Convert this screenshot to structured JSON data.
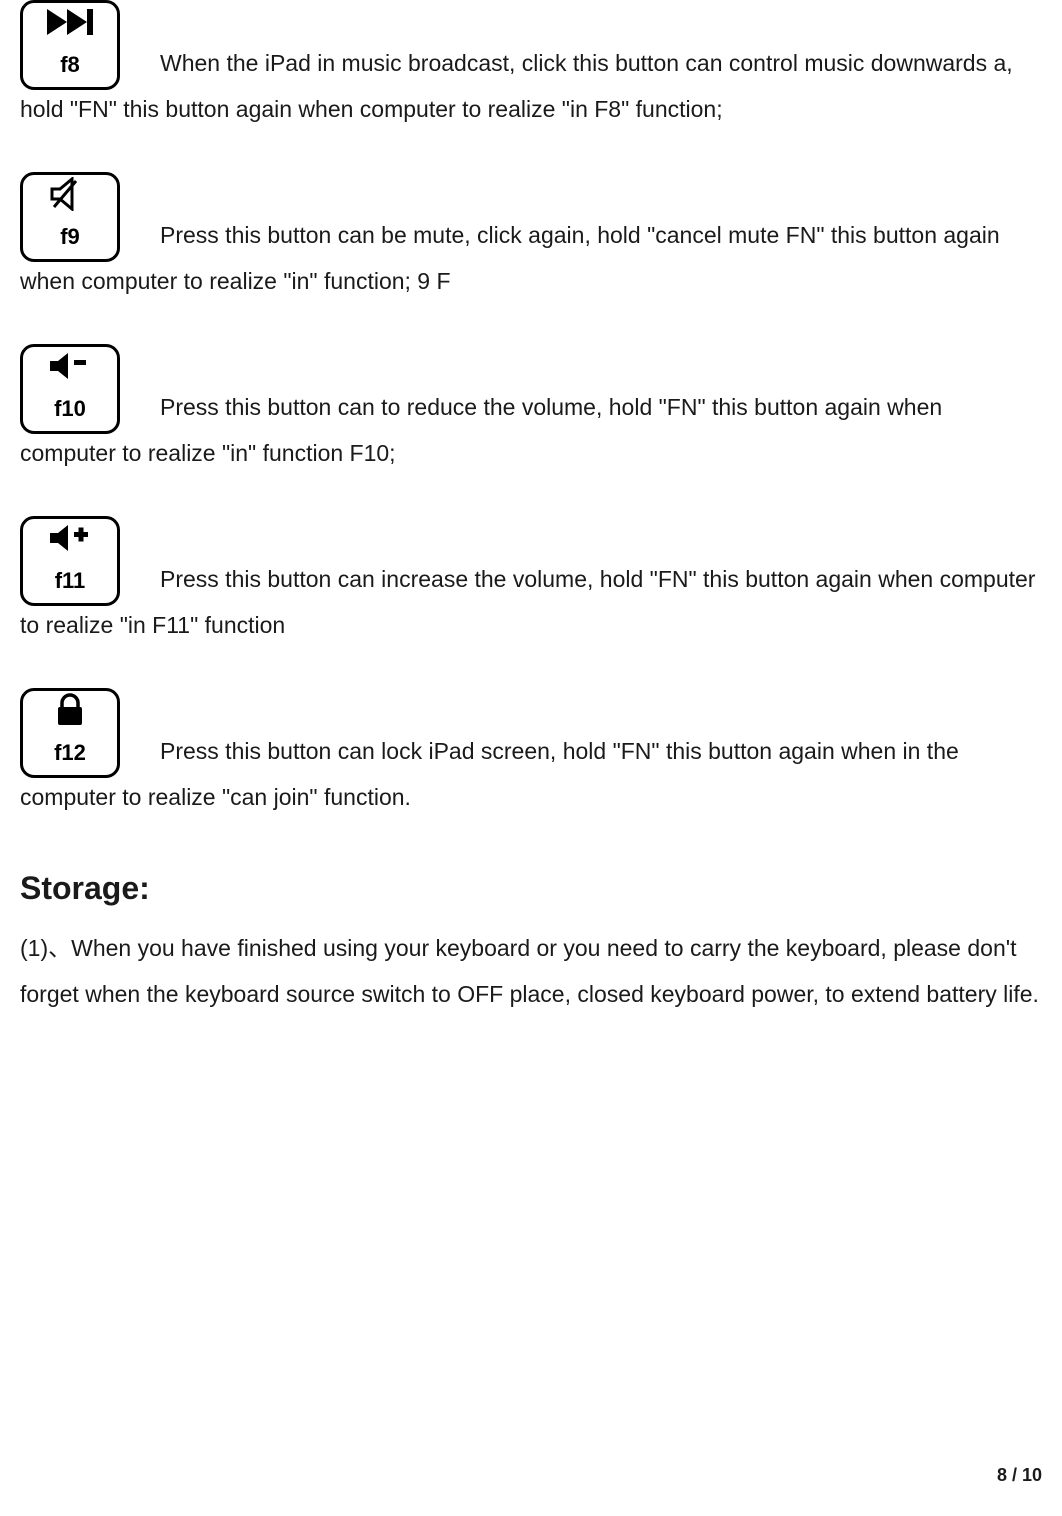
{
  "keys": [
    {
      "label": "f8",
      "text": "When the iPad in music broadcast, click this button can control music downwards a, hold \"FN\" this button again when computer to realize \"in F8\" function;"
    },
    {
      "label": "f9",
      "text": "Press this button can be mute, click again, hold \"cancel mute FN\" this button again when computer to realize \"in\" function; 9 F"
    },
    {
      "label": "f10",
      "text": "Press this button can to reduce the volume, hold \"FN\" this button again when computer to realize \"in\" function F10;"
    },
    {
      "label": "f11",
      "text": "Press this button can increase the volume, hold \"FN\" this button again when computer to realize \"in F11\" function"
    },
    {
      "label": "f12",
      "text": "Press this button can lock iPad screen,  hold \"FN\" this button again when in the computer to realize \"can join\" function."
    }
  ],
  "storage": {
    "heading": "Storage:",
    "item1": "(1)、When you have finished using your keyboard or you need to carry the keyboard, please don't forget when the keyboard source switch to OFF place, closed keyboard power, to extend battery life."
  },
  "footer": "8 / 10"
}
